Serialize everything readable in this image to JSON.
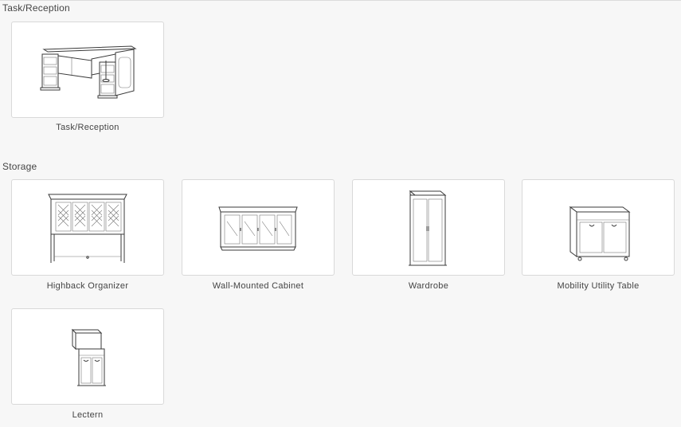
{
  "sections": [
    {
      "title": "Task/Reception",
      "items": [
        {
          "label": "Task/Reception",
          "icon": "reception-desk-icon"
        }
      ]
    },
    {
      "title": "Storage",
      "items": [
        {
          "label": "Highback Organizer",
          "icon": "highback-organizer-icon"
        },
        {
          "label": "Wall-Mounted Cabinet",
          "icon": "wall-cabinet-icon"
        },
        {
          "label": "Wardrobe",
          "icon": "wardrobe-icon"
        },
        {
          "label": "Mobility Utility Table",
          "icon": "utility-table-icon"
        },
        {
          "label": "Lectern",
          "icon": "lectern-icon"
        }
      ]
    }
  ]
}
